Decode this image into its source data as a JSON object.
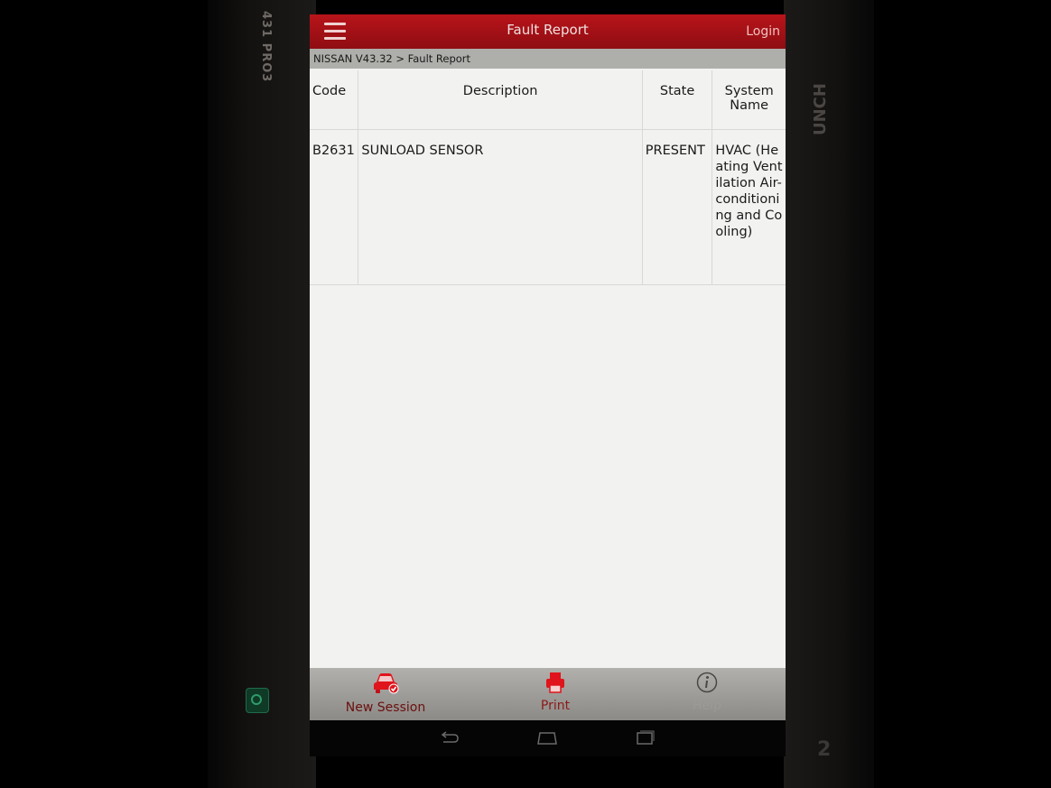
{
  "device": {
    "brand_left": "431 PRO3",
    "brand_right": "UNCH",
    "brand_number": "2"
  },
  "header": {
    "title": "Fault Report",
    "login_label": "Login"
  },
  "breadcrumb": "NISSAN V43.32 > Fault Report",
  "table": {
    "columns": [
      "Code",
      "Description",
      "State",
      "System Name"
    ],
    "rows": [
      {
        "code": "B2631",
        "description": "SUNLOAD SENSOR",
        "state": "PRESENT",
        "system_name": "HVAC (Heating Ventilation Air-conditioning and Cooling)"
      }
    ]
  },
  "bottombar": {
    "new_session_label": "New Session",
    "print_label": "Print",
    "help_label": "Help"
  },
  "icons": {
    "menu": "hamburger-menu-icon",
    "new_session": "car-check-icon",
    "print": "printer-icon",
    "help": "info-icon",
    "nav_back": "back-arrow-icon",
    "nav_home": "home-icon",
    "nav_recent": "recent-apps-icon"
  },
  "colors": {
    "titlebar": "#a8111a",
    "accent_red": "#e0141c",
    "breadcrumb_bg": "#aeaeaa",
    "bottombar_bg": "#a6a4a0"
  }
}
